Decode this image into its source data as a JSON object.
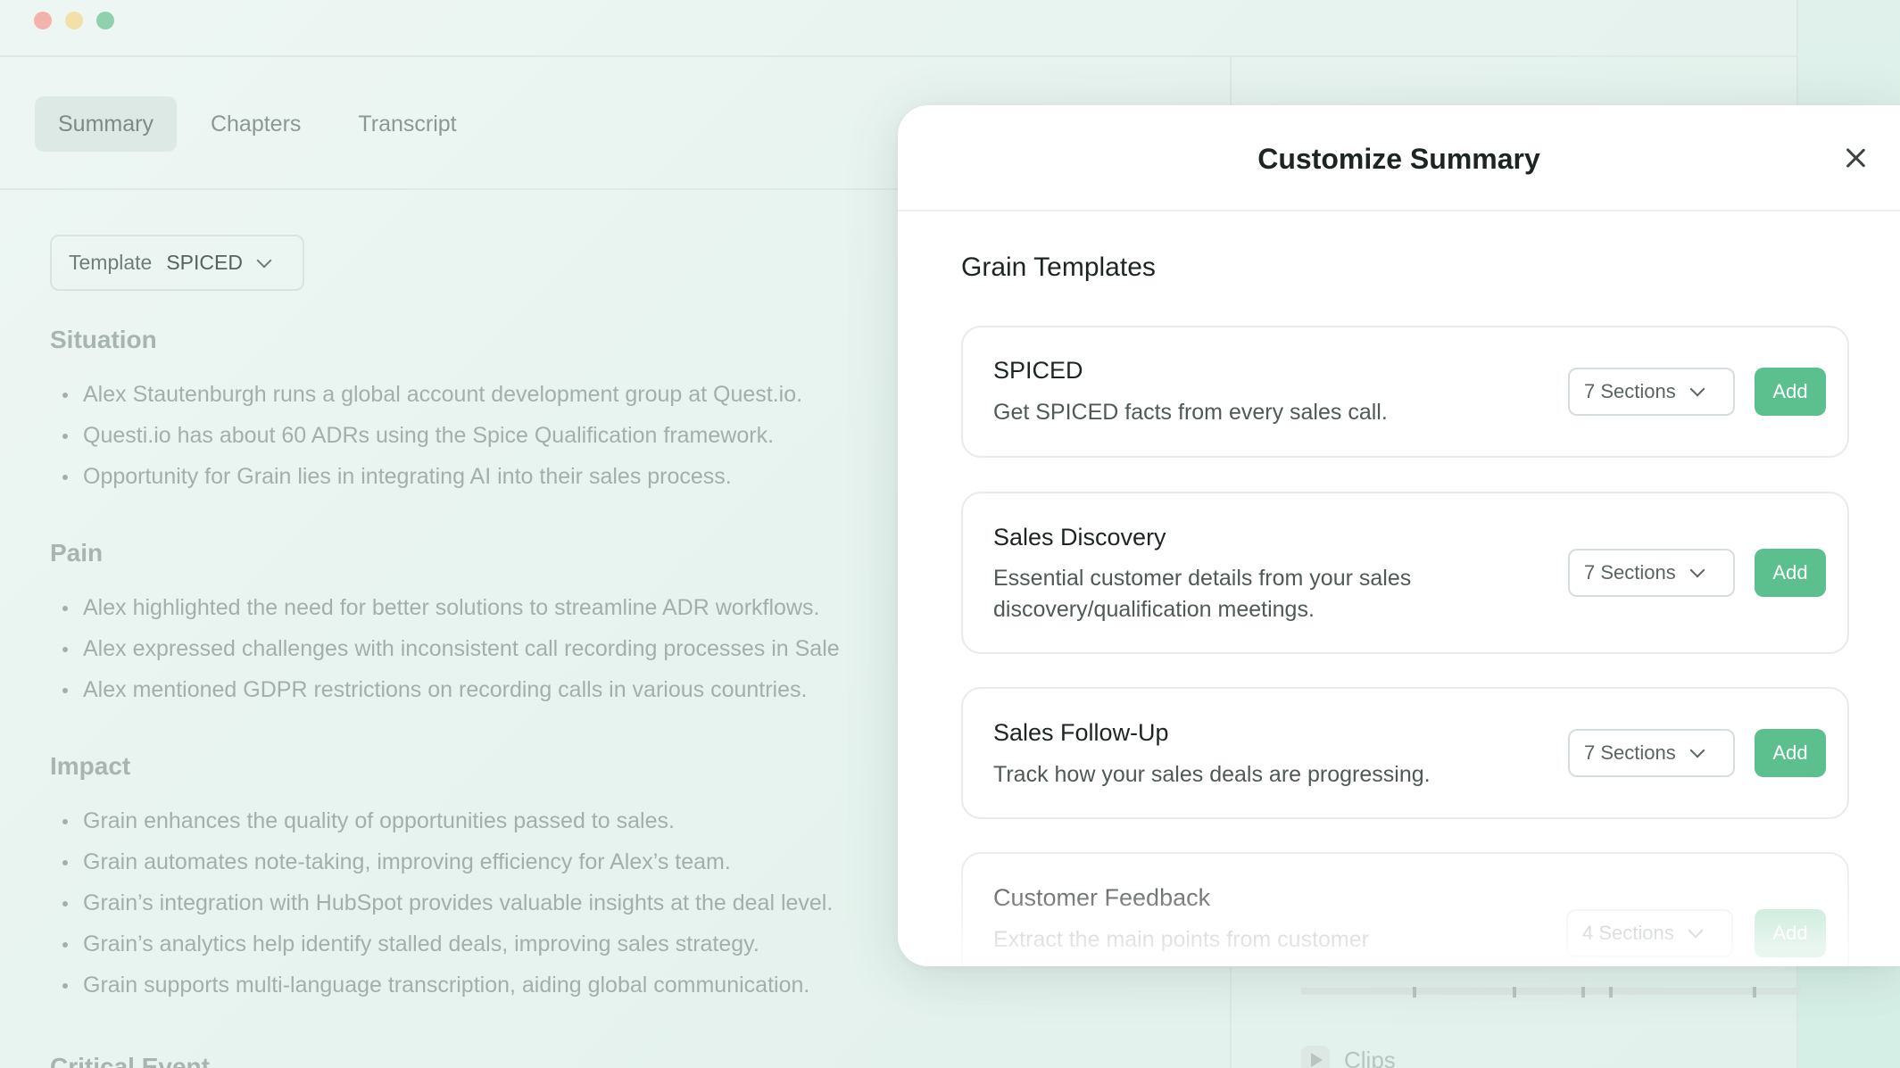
{
  "tabs": [
    "Summary",
    "Chapters",
    "Transcript"
  ],
  "template_select": {
    "label": "Template",
    "value": "SPICED"
  },
  "summary_sections": [
    {
      "heading": "Situation",
      "bullets": [
        "Alex Stautenburgh runs a global account development group at Quest.io.",
        "Questi.io has about 60 ADRs using the Spice Qualification framework.",
        "Opportunity for Grain lies in integrating AI into their sales process."
      ]
    },
    {
      "heading": "Pain",
      "bullets": [
        "Alex highlighted the need for better solutions to streamline ADR workflows.",
        "Alex expressed challenges with inconsistent call recording processes in Sale",
        "Alex mentioned GDPR restrictions on recording calls in various countries."
      ]
    },
    {
      "heading": "Impact",
      "bullets": [
        "Grain enhances the quality of opportunities passed to sales.",
        "Grain automates note-taking, improving efficiency for Alex’s team.",
        "Grain’s integration with HubSpot provides valuable insights at the deal level.",
        "Grain’s analytics help identify stalled deals, improving sales strategy.",
        "Grain supports multi-language transcription, aiding global communication."
      ]
    },
    {
      "heading": "Critical Event",
      "bullets": []
    }
  ],
  "clips_label": "Clips",
  "modal": {
    "title": "Customize Summary",
    "subtitle": "Grain Templates",
    "templates": [
      {
        "name": "SPICED",
        "description": "Get SPICED facts from every sales call.",
        "sections": "7 Sections",
        "add_label": "Add"
      },
      {
        "name": "Sales Discovery",
        "description": "Essential customer details from your sales discovery/qualification meetings.",
        "sections": "7 Sections",
        "add_label": "Add"
      },
      {
        "name": "Sales Follow-Up",
        "description": "Track how your sales deals are progressing.",
        "sections": "7 Sections",
        "add_label": "Add"
      },
      {
        "name": "Customer Feedback",
        "description": "Extract the main points from customer",
        "sections": "4 Sections",
        "add_label": "Add"
      }
    ]
  },
  "colors": {
    "accent_green": "#5bc08e",
    "background": "#e6f2ee"
  }
}
